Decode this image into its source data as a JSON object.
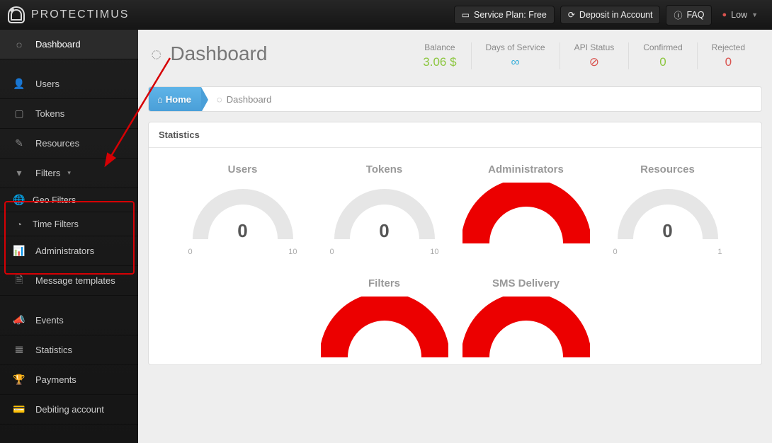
{
  "brand": "PROTECTIMUS",
  "topbar": {
    "service_plan": "Service Plan: Free",
    "deposit": "Deposit in Account",
    "faq": "FAQ",
    "user": "Low"
  },
  "sidebar": {
    "dashboard": "Dashboard",
    "users": "Users",
    "tokens": "Tokens",
    "resources": "Resources",
    "filters": "Filters",
    "geo_filters": "Geo Filters",
    "time_filters": "Time Filters",
    "administrators": "Administrators",
    "message_templates": "Message templates",
    "events": "Events",
    "statistics": "Statistics",
    "payments": "Payments",
    "debiting_account": "Debiting account"
  },
  "page": {
    "title": "Dashboard",
    "home": "Home",
    "crumb": "Dashboard",
    "panel_title": "Statistics"
  },
  "header_stats": {
    "balance_label": "Balance",
    "balance_val": "3.06 $",
    "days_label": "Days of Service",
    "days_val": "∞",
    "api_label": "API Status",
    "confirmed_label": "Confirmed",
    "confirmed_val": "0",
    "rejected_label": "Rejected",
    "rejected_val": "0"
  },
  "gauges": {
    "users": {
      "title": "Users",
      "value": "0",
      "min": "0",
      "max": "10"
    },
    "tokens": {
      "title": "Tokens",
      "value": "0",
      "min": "0",
      "max": "10"
    },
    "administrators": {
      "title": "Administrators"
    },
    "resources": {
      "title": "Resources",
      "value": "0",
      "min": "0",
      "max": "1"
    },
    "filters": {
      "title": "Filters"
    },
    "sms": {
      "title": "SMS Delivery"
    }
  },
  "chart_data": [
    {
      "type": "gauge",
      "name": "Users",
      "value": 0,
      "min": 0,
      "max": 10,
      "color": "#e6e6e6"
    },
    {
      "type": "gauge",
      "name": "Tokens",
      "value": 0,
      "min": 0,
      "max": 10,
      "color": "#e6e6e6"
    },
    {
      "type": "gauge",
      "name": "Administrators",
      "value": null,
      "min": 0,
      "max": 1,
      "color": "#ec0000",
      "full": true
    },
    {
      "type": "gauge",
      "name": "Resources",
      "value": 0,
      "min": 0,
      "max": 1,
      "color": "#e6e6e6"
    },
    {
      "type": "gauge",
      "name": "Filters",
      "value": null,
      "min": 0,
      "max": 1,
      "color": "#ec0000",
      "full": true
    },
    {
      "type": "gauge",
      "name": "SMS Delivery",
      "value": null,
      "min": 0,
      "max": 100,
      "color": "#ec0000",
      "full": true
    }
  ]
}
